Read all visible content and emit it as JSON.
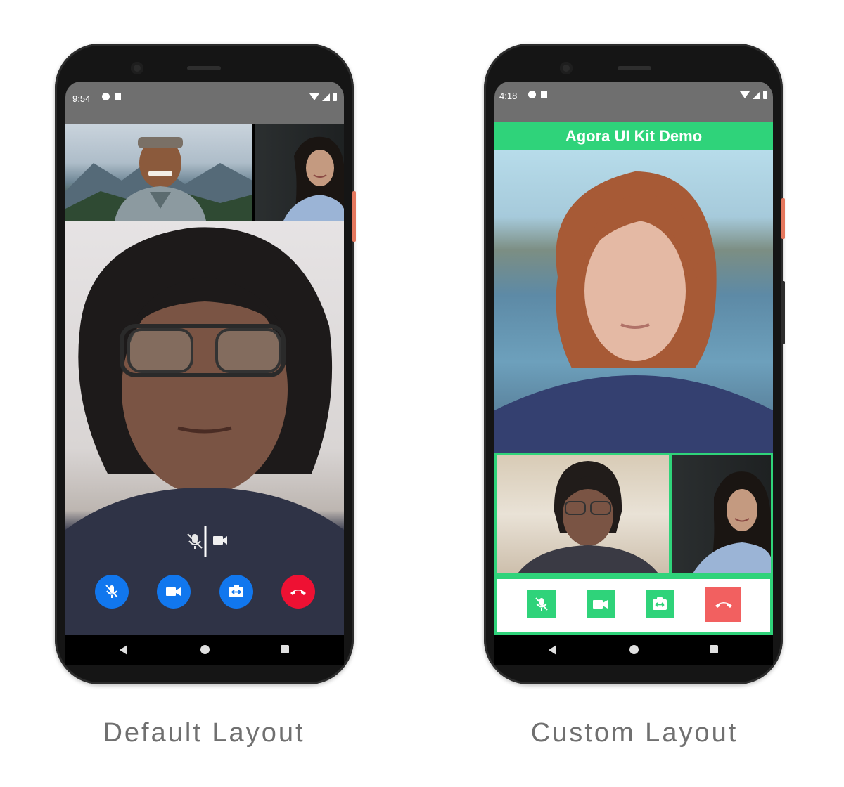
{
  "captions": {
    "left": "Default Layout",
    "right": "Custom Layout"
  },
  "left_phone": {
    "status_time": "9:54",
    "buttons": [
      "mic-off",
      "video",
      "switch-camera",
      "end-call"
    ],
    "overlay_icons": [
      "mic-off",
      "video"
    ]
  },
  "right_phone": {
    "status_time": "4:18",
    "app_title": "Agora UI Kit Demo",
    "buttons": [
      "mic-off",
      "video",
      "switch-camera",
      "end-call"
    ]
  },
  "colors": {
    "agora_blue": "#1177ee",
    "end_call_red": "#ee1133",
    "custom_green": "#2fd37a",
    "custom_red": "#f26060",
    "status_gray": "#6f6f6f"
  }
}
